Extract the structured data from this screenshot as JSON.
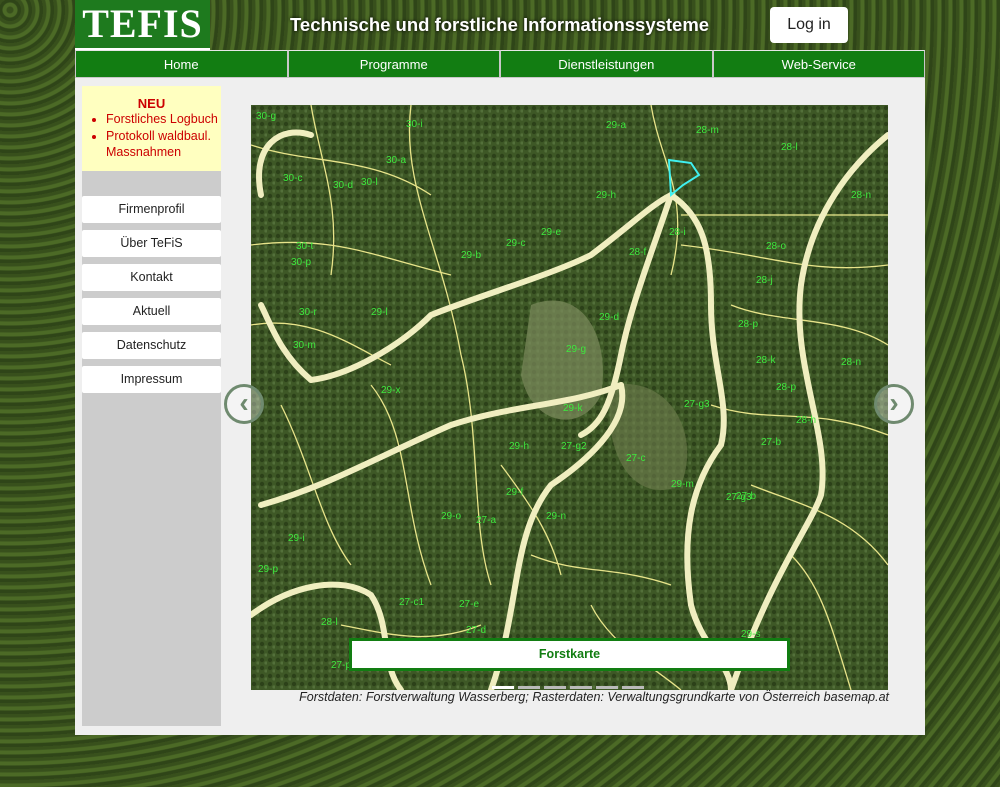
{
  "header": {
    "logo_text": "TEFIS",
    "title": "Technische und forstliche Informationssysteme",
    "login_label": "Log in"
  },
  "nav": {
    "items": [
      "Home",
      "Programme",
      "Dienstleistungen",
      "Web-Service"
    ]
  },
  "news": {
    "title": "NEU",
    "items": [
      "Forstliches Logbuch",
      "Protokoll waldbaul. Massnahmen"
    ]
  },
  "sidebar": {
    "buttons": [
      "Firmenprofil",
      "Über TeFiS",
      "Kontakt",
      "Aktuell",
      "Datenschutz",
      "Impressum"
    ]
  },
  "carousel": {
    "caption": "Forstkarte",
    "slide_count": 6,
    "active_slide": 1,
    "prev_icon": "‹",
    "next_icon": "›"
  },
  "map": {
    "labels": [
      "30-g",
      "30-i",
      "30-a",
      "29-a",
      "28-m",
      "28-l",
      "30-c",
      "30-d",
      "30-l",
      "29-h",
      "28-n",
      "29-b",
      "29-e",
      "28-i",
      "28-o",
      "30-t",
      "30-p",
      "29-c",
      "28-f",
      "28-j",
      "30-r",
      "29-l",
      "29-d",
      "28-p",
      "30-m",
      "29-g",
      "28-k",
      "29-x",
      "28-n",
      "28-p",
      "27-g3",
      "28-h",
      "29-k",
      "29-h",
      "27-b",
      "27-g2",
      "27-c",
      "29-m",
      "29-f",
      "29-n",
      "27-a",
      "27-b",
      "27-g3",
      "29-o",
      "29-i",
      "27-c1",
      "29-p",
      "27-e",
      "27-d",
      "28-l",
      "27-p",
      "29-s"
    ]
  },
  "footer": {
    "source_text": "Forstdaten: Forstverwaltung Wasserberg; Rasterdaten: Verwaltungsgrundkarte von Österreich basemap.at"
  }
}
